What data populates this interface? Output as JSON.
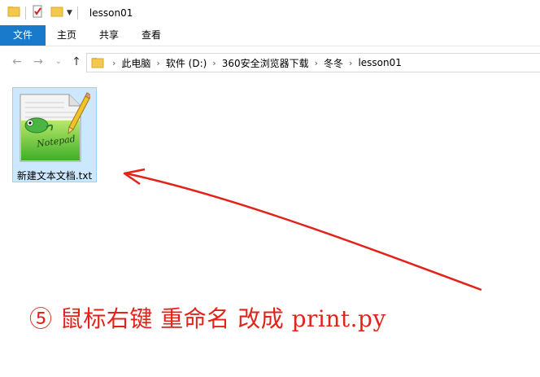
{
  "window": {
    "title": "lesson01"
  },
  "ribbon": {
    "tabs": [
      {
        "label": "文件"
      },
      {
        "label": "主页"
      },
      {
        "label": "共享"
      },
      {
        "label": "查看"
      }
    ]
  },
  "address": {
    "crumbs": [
      {
        "label": "此电脑"
      },
      {
        "label": "软件 (D:)"
      },
      {
        "label": "360安全浏览器下载"
      },
      {
        "label": "冬冬"
      },
      {
        "label": "lesson01"
      }
    ]
  },
  "files": [
    {
      "name": "新建文本文档.txt",
      "icon": "notepad-plus-plus-icon"
    }
  ],
  "annotation": {
    "text": "⑤ 鼠标右键 重命名 改成 print.py",
    "color": "#e2231a"
  },
  "colors": {
    "file_tab": "#1979ca",
    "selection_fill": "#cce8ff",
    "selection_border": "#99d1ff"
  }
}
